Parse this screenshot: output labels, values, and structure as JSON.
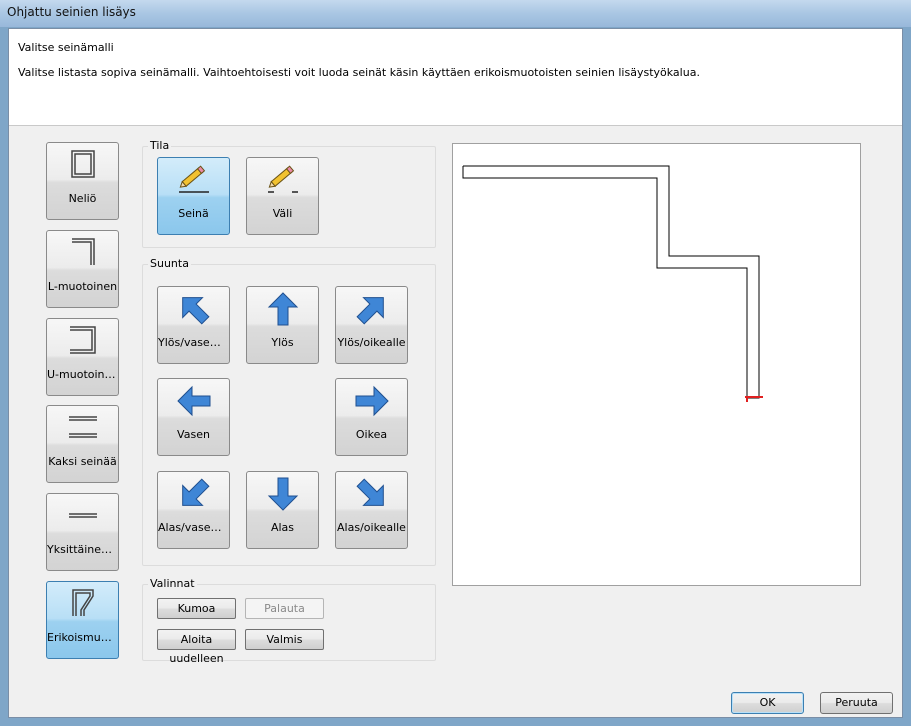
{
  "window": {
    "title": "Ohjattu seinien lisäys"
  },
  "header": {
    "heading": "Valitse seinämalli",
    "description": "Valitse listasta sopiva seinämalli. Vaihtoehtoisesti voit luoda seinät käsin käyttäen erikoismuotoisten seinien lisäystyökalua."
  },
  "templates": [
    {
      "label": "Neliö",
      "icon": "square-wall-icon",
      "selected": false
    },
    {
      "label": "L-muotoinen",
      "icon": "l-shape-wall-icon",
      "selected": false
    },
    {
      "label": "U-muotoinen",
      "icon": "u-shape-wall-icon",
      "selected": false
    },
    {
      "label": "Kaksi seinää",
      "icon": "two-walls-icon",
      "selected": false
    },
    {
      "label": "Yksittäinen s...",
      "icon": "single-wall-icon",
      "selected": false
    },
    {
      "label": "Erikoismuotoi...",
      "icon": "custom-shape-wall-icon",
      "selected": true
    }
  ],
  "mode": {
    "label": "Tila",
    "options": [
      {
        "label": "Seinä",
        "icon": "pencil-wall-icon",
        "selected": true
      },
      {
        "label": "Väli",
        "icon": "pencil-gap-icon",
        "selected": false
      }
    ]
  },
  "direction": {
    "label": "Suunta",
    "buttons": {
      "up_left": "Ylös/vasem...",
      "up": "Ylös",
      "up_right": "Ylös/oikealle",
      "left": "Vasen",
      "right": "Oikea",
      "down_left": "Alas/vasem...",
      "down": "Alas",
      "down_right": "Alas/oikealle"
    }
  },
  "options": {
    "label": "Valinnat",
    "undo": "Kumoa",
    "redo": "Palauta",
    "restart": "Aloita uudelleen",
    "done": "Valmis"
  },
  "footer": {
    "ok": "OK",
    "cancel": "Peruuta"
  },
  "colors": {
    "selected": "#8bc7ec",
    "arrow": "#3f86d6",
    "marker": "#e02020"
  }
}
